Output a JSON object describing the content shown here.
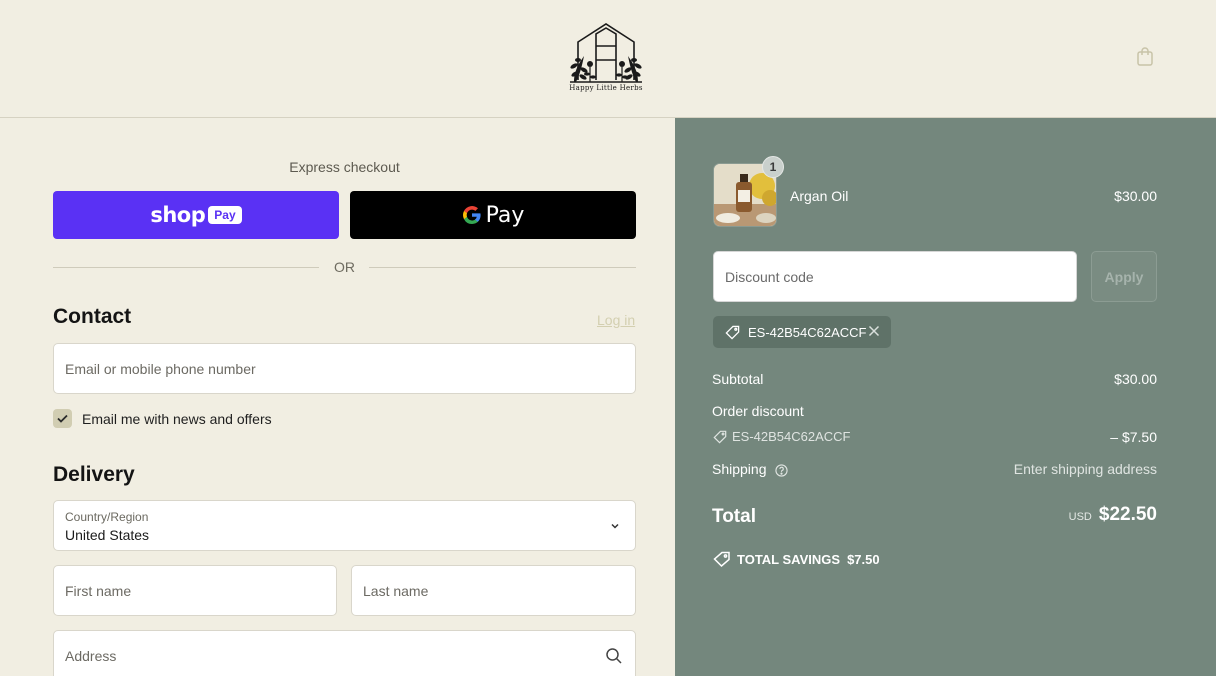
{
  "brand": {
    "name": "Happy Little Herbs"
  },
  "header": {
    "cart_icon": "shopping-bag-icon"
  },
  "express": {
    "title": "Express checkout",
    "shop_pay": {
      "word": "shop",
      "badge": "Pay",
      "color": "#5a31f4"
    },
    "google_pay": {
      "word": "Pay"
    },
    "or": "OR"
  },
  "contact": {
    "heading": "Contact",
    "login": "Log in",
    "email_placeholder": "Email or mobile phone number",
    "newsletter_label": "Email me with news and offers",
    "newsletter_checked": true
  },
  "delivery": {
    "heading": "Delivery",
    "country_label": "Country/Region",
    "country_value": "United States",
    "first_name_placeholder": "First name",
    "last_name_placeholder": "Last name",
    "address_placeholder": "Address"
  },
  "summary": {
    "product": {
      "name": "Argan Oil",
      "price": "$30.00",
      "quantity": "1"
    },
    "discount_placeholder": "Discount code",
    "apply": "Apply",
    "applied_code": "ES-42B54C62ACCF",
    "subtotal_label": "Subtotal",
    "subtotal_value": "$30.00",
    "order_discount_label": "Order discount",
    "order_discount_code": "ES-42B54C62ACCF",
    "order_discount_value": "– $7.50",
    "shipping_label": "Shipping",
    "shipping_value": "Enter shipping address",
    "total_label": "Total",
    "currency": "USD",
    "total_value": "$22.50",
    "savings_label": "TOTAL SAVINGS",
    "savings_value": "$7.50"
  },
  "colors": {
    "page_bg": "#f1eee2",
    "summary_bg": "#74877d",
    "accent": "#5a31f4"
  }
}
